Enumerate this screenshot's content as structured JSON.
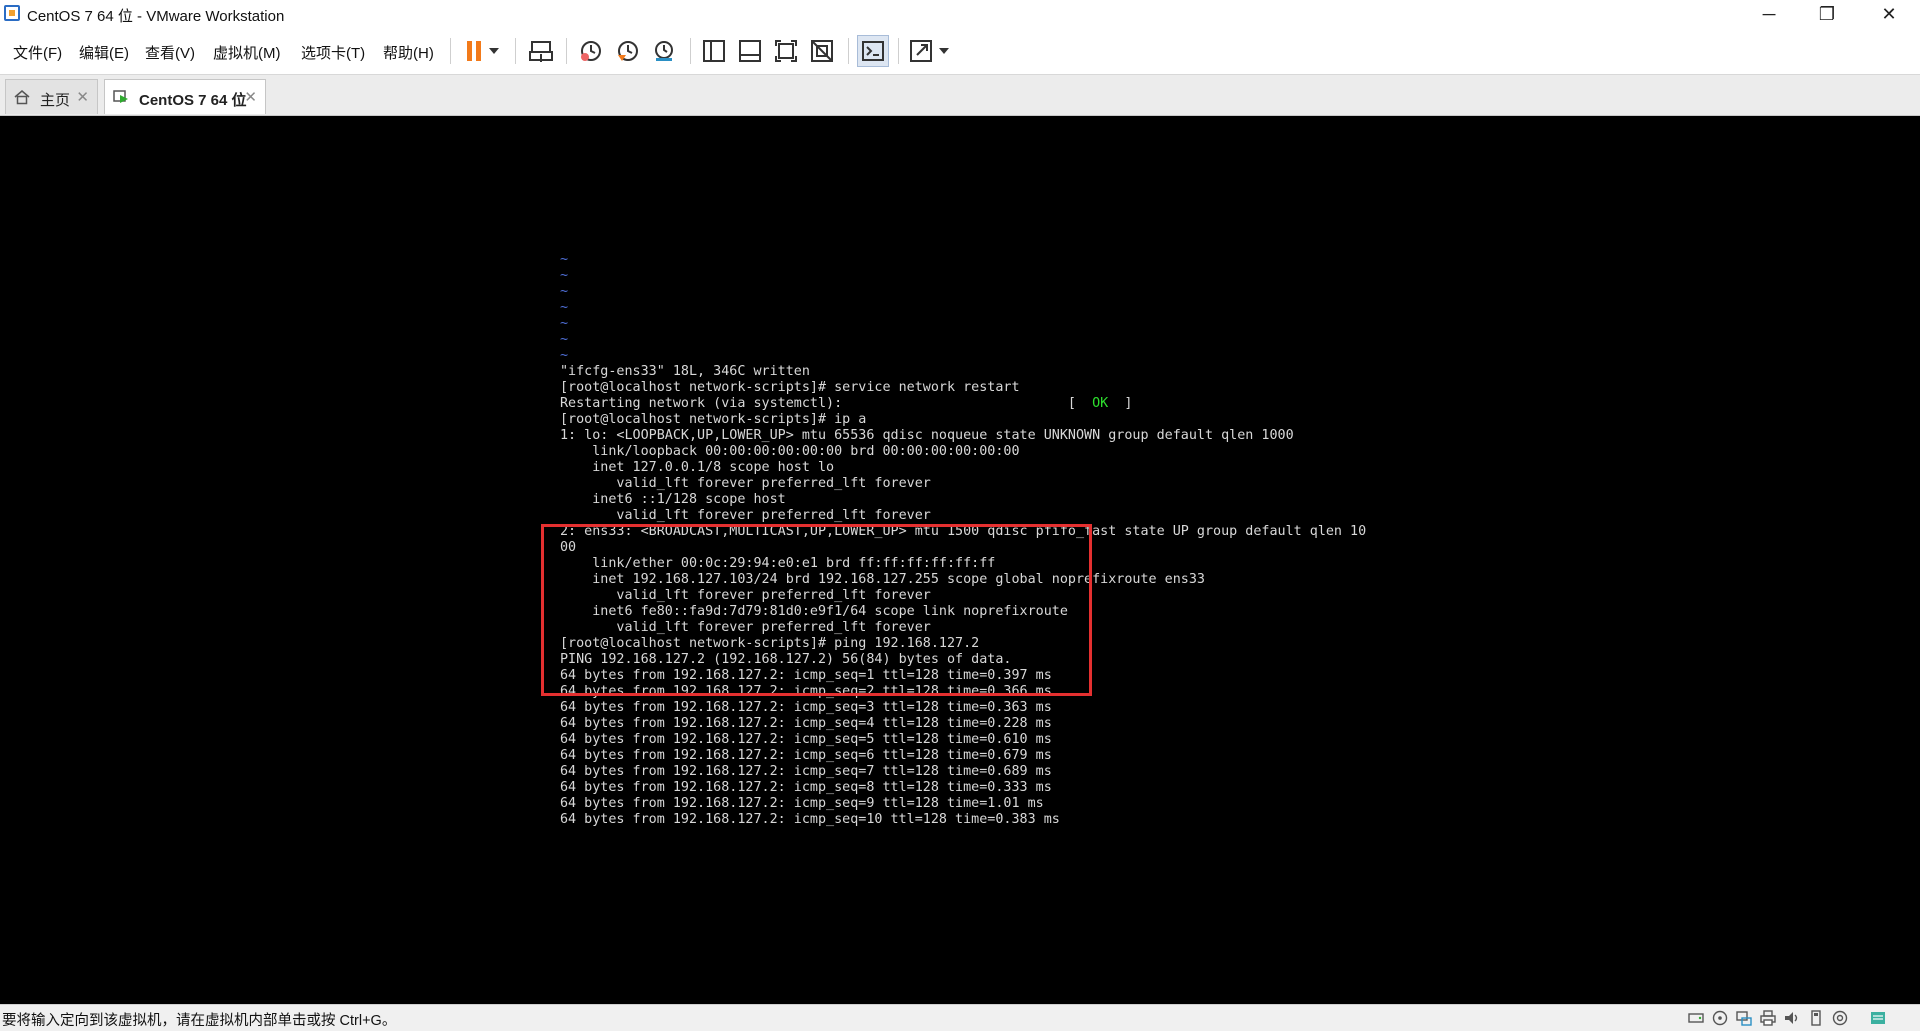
{
  "window": {
    "title": "CentOS 7 64 位 - VMware Workstation",
    "controls": [
      "─",
      "❐",
      "✕"
    ]
  },
  "menu": [
    "文件(F)",
    "编辑(E)",
    "查看(V)",
    "虚拟机(M)",
    "选项卡(T)",
    "帮助(H)"
  ],
  "toolbar": {
    "icons": [
      "pause-icon",
      "dropdown-arrow-icon",
      "send-ctrl-alt-del-icon",
      "snapshot-take-icon",
      "snapshot-revert-icon",
      "snapshot-manager-icon",
      "library-view-icon",
      "thumbnail-bar-icon",
      "full-screen-icon",
      "unity-icon",
      "console-view-icon",
      "stretch-guest-icon",
      "dropdown-arrow-icon"
    ],
    "accent_color": "#f27a1a"
  },
  "tabs": [
    {
      "label": "主页",
      "icon": "home-icon",
      "active": false
    },
    {
      "label": "CentOS 7 64 位",
      "icon": "vm-running-icon",
      "active": true
    }
  ],
  "console": {
    "tildes": [
      "~",
      "~",
      "~",
      "~",
      "~",
      "~",
      "~"
    ],
    "lines": [
      "\"ifcfg-ens33\" 18L, 346C written",
      "[root@localhost network-scripts]# service network restart",
      "Restarting network (via systemctl):",
      "[root@localhost network-scripts]# ip a",
      "1: lo: <LOOPBACK,UP,LOWER_UP> mtu 65536 qdisc noqueue state UNKNOWN group default qlen 1000",
      "    link/loopback 00:00:00:00:00:00 brd 00:00:00:00:00:00",
      "    inet 127.0.0.1/8 scope host lo",
      "       valid_lft forever preferred_lft forever",
      "    inet6 ::1/128 scope host",
      "       valid_lft forever preferred_lft forever",
      "2: ens33: <BROADCAST,MULTICAST,UP,LOWER_UP> mtu 1500 qdisc pfifo_fast state UP group default qlen 10",
      "00",
      "    link/ether 00:0c:29:94:e0:e1 brd ff:ff:ff:ff:ff:ff",
      "    inet 192.168.127.103/24 brd 192.168.127.255 scope global noprefixroute ens33",
      "       valid_lft forever preferred_lft forever",
      "    inet6 fe80::fa9d:7d79:81d0:e9f1/64 scope link noprefixroute",
      "       valid_lft forever preferred_lft forever",
      "[root@localhost network-scripts]# ping 192.168.127.2",
      "PING 192.168.127.2 (192.168.127.2) 56(84) bytes of data.",
      "64 bytes from 192.168.127.2: icmp_seq=1 ttl=128 time=0.397 ms",
      "64 bytes from 192.168.127.2: icmp_seq=2 ttl=128 time=0.366 ms",
      "64 bytes from 192.168.127.2: icmp_seq=3 ttl=128 time=0.363 ms",
      "64 bytes from 192.168.127.2: icmp_seq=4 ttl=128 time=0.228 ms",
      "64 bytes from 192.168.127.2: icmp_seq=5 ttl=128 time=0.610 ms",
      "64 bytes from 192.168.127.2: icmp_seq=6 ttl=128 time=0.679 ms",
      "64 bytes from 192.168.127.2: icmp_seq=7 ttl=128 time=0.689 ms",
      "64 bytes from 192.168.127.2: icmp_seq=8 ttl=128 time=0.333 ms",
      "64 bytes from 192.168.127.2: icmp_seq=9 ttl=128 time=1.01 ms",
      "64 bytes from 192.168.127.2: icmp_seq=10 ttl=128 time=0.383 ms"
    ],
    "status_open": "[  ",
    "status_ok": "OK",
    "status_close": "  ]",
    "ok_color": "#2ee02e",
    "tilde_color": "#4f6fd8",
    "highlight_color": "#e53030"
  },
  "statusbar": {
    "hint": "要将输入定向到该虚拟机，请在虚拟机内部单击或按 Ctrl+G。",
    "device_icons": [
      "hard-disk-icon",
      "cd-dvd-icon",
      "network-adapter-icon",
      "printer-icon",
      "sound-icon",
      "usb-icon",
      "display-icon",
      "message-icon"
    ]
  }
}
